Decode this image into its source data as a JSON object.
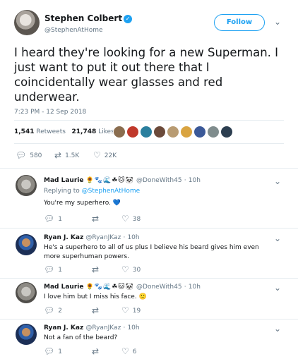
{
  "tweet": {
    "name": "Stephen Colbert",
    "handle": "@StephenAtHome",
    "follow_label": "Follow",
    "text": "I heard they're looking for a new Superman. I just want to put it out there that I coincidentally wear glasses and red underwear.",
    "timestamp": "7:23 PM - 12 Sep 2018",
    "retweets_count": "1,541",
    "retweets_label": "Retweets",
    "likes_count": "21,748",
    "likes_label": "Likes",
    "replies": "580",
    "retweets_short": "1.5K",
    "likes_short": "22K"
  },
  "replies": [
    {
      "name": "Mad Laurie",
      "emojis": "🌻🐾🌊☘🐱🐼",
      "handle": "@DoneWith45",
      "time": "10h",
      "replying_label": "Replying to",
      "replying_to": "@StephenAtHome",
      "text": "You're my superhero. 💙",
      "replies": "1",
      "retweets": "",
      "likes": "38"
    },
    {
      "name": "Ryan J. Kaz",
      "handle": "@RyanJKaz",
      "time": "10h",
      "text": "He's a superhero to all of us plus I believe his beard gives him even more superhuman powers.",
      "replies": "1",
      "retweets": "",
      "likes": "30"
    },
    {
      "name": "Mad Laurie",
      "emojis": "🌻🐾🌊☘🐱🐼",
      "handle": "@DoneWith45",
      "time": "10h",
      "text": "I love him but I miss his face. 🙁",
      "replies": "2",
      "retweets": "",
      "likes": "19"
    },
    {
      "name": "Ryan J. Kaz",
      "handle": "@RyanJKaz",
      "time": "10h",
      "text": "Not a fan of the beard?",
      "replies": "1",
      "retweets": "",
      "likes": "6"
    }
  ],
  "icons": {
    "reply": "reply-icon",
    "retweet": "retweet-icon",
    "like": "heart-icon",
    "verified": "verified-badge-icon",
    "more": "chevron-down-icon"
  },
  "colors": {
    "accent": "#1da1f2",
    "secondary_text": "#657786",
    "divider": "#e6ecf0"
  }
}
